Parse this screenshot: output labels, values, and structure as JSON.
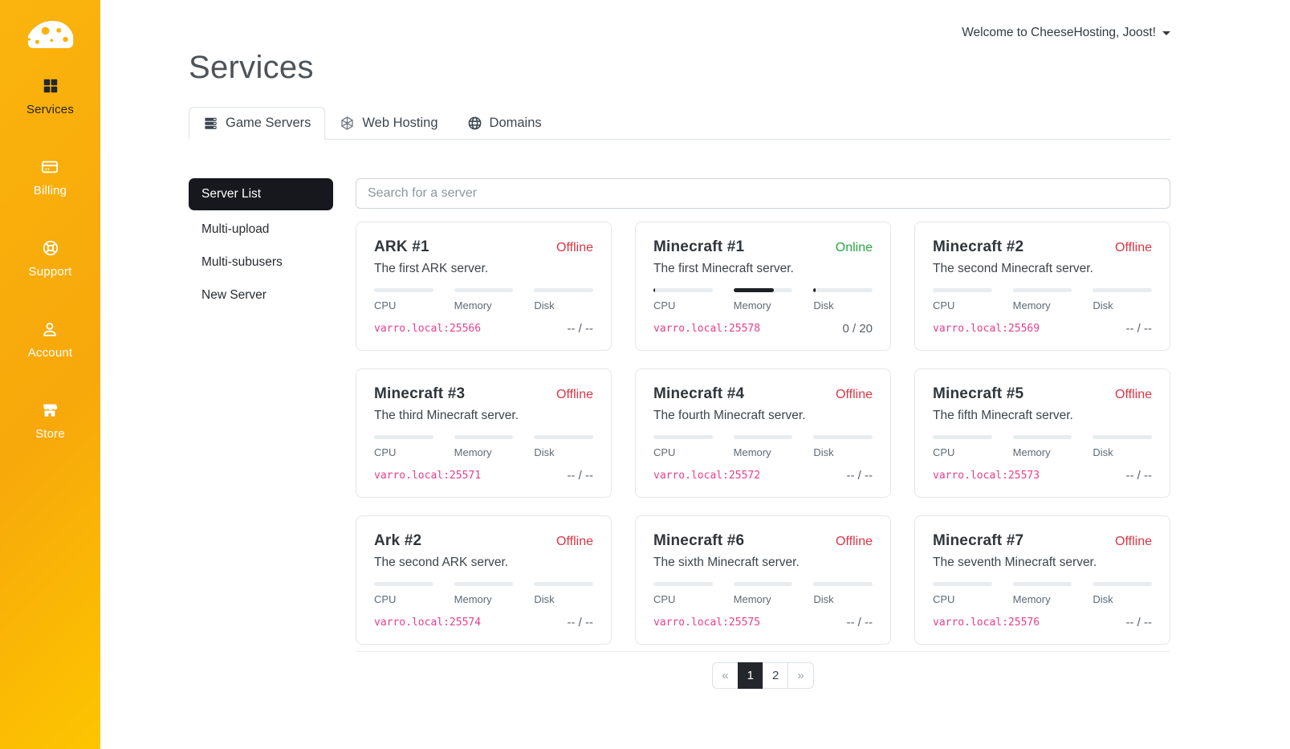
{
  "colors": {
    "brand_from": "#fbb40d",
    "brand_mid": "#f7a80b",
    "brand_to": "#fdc500",
    "dark": "#1d2025",
    "online": "#28a745",
    "offline": "#dc3545",
    "address": "#e83e8c"
  },
  "sidebar": {
    "items": [
      {
        "label": "Services",
        "icon": "grid",
        "active": true
      },
      {
        "label": "Billing",
        "icon": "credit-card",
        "active": false
      },
      {
        "label": "Support",
        "icon": "life-ring",
        "active": false
      },
      {
        "label": "Account",
        "icon": "user",
        "active": false
      },
      {
        "label": "Store",
        "icon": "store",
        "active": false
      }
    ]
  },
  "header": {
    "welcome": "Welcome to CheeseHosting, Joost!"
  },
  "page": {
    "title": "Services"
  },
  "tabs": [
    {
      "label": "Game Servers",
      "icon": "server",
      "active": true
    },
    {
      "label": "Web Hosting",
      "icon": "hexagon",
      "active": false
    },
    {
      "label": "Domains",
      "icon": "globe",
      "active": false
    }
  ],
  "subnav": [
    {
      "label": "Server List",
      "active": true
    },
    {
      "label": "Multi-upload",
      "active": false
    },
    {
      "label": "Multi-subusers",
      "active": false
    },
    {
      "label": "New Server",
      "active": false
    }
  ],
  "search": {
    "placeholder": "Search for a server"
  },
  "metrics": {
    "cpu": "CPU",
    "memory": "Memory",
    "disk": "Disk"
  },
  "servers": [
    {
      "name": "ARK #1",
      "status": "Offline",
      "description": "The first ARK server.",
      "address": "varro.local:25566",
      "players": "-- / --",
      "cpu": 0,
      "memory": 0,
      "disk": 0
    },
    {
      "name": "Minecraft #1",
      "status": "Online",
      "description": "The first Minecraft server.",
      "address": "varro.local:25578",
      "players": "0 / 20",
      "cpu": 3,
      "memory": 68,
      "disk": 4
    },
    {
      "name": "Minecraft #2",
      "status": "Offline",
      "description": "The second Minecraft server.",
      "address": "varro.local:25569",
      "players": "-- / --",
      "cpu": 0,
      "memory": 0,
      "disk": 0
    },
    {
      "name": "Minecraft #3",
      "status": "Offline",
      "description": "The third Minecraft server.",
      "address": "varro.local:25571",
      "players": "-- / --",
      "cpu": 0,
      "memory": 0,
      "disk": 0
    },
    {
      "name": "Minecraft #4",
      "status": "Offline",
      "description": "The fourth Minecraft server.",
      "address": "varro.local:25572",
      "players": "-- / --",
      "cpu": 0,
      "memory": 0,
      "disk": 0
    },
    {
      "name": "Minecraft #5",
      "status": "Offline",
      "description": "The fifth Minecraft server.",
      "address": "varro.local:25573",
      "players": "-- / --",
      "cpu": 0,
      "memory": 0,
      "disk": 0
    },
    {
      "name": "Ark #2",
      "status": "Offline",
      "description": "The second ARK server.",
      "address": "varro.local:25574",
      "players": "-- / --",
      "cpu": 0,
      "memory": 0,
      "disk": 0
    },
    {
      "name": "Minecraft #6",
      "status": "Offline",
      "description": "The sixth Minecraft server.",
      "address": "varro.local:25575",
      "players": "-- / --",
      "cpu": 0,
      "memory": 0,
      "disk": 0
    },
    {
      "name": "Minecraft #7",
      "status": "Offline",
      "description": "The seventh Minecraft server.",
      "address": "varro.local:25576",
      "players": "-- / --",
      "cpu": 0,
      "memory": 0,
      "disk": 0
    }
  ],
  "pagination": {
    "prev": "«",
    "next": "»",
    "pages": [
      {
        "label": "1",
        "active": true
      },
      {
        "label": "2",
        "active": false
      }
    ]
  }
}
